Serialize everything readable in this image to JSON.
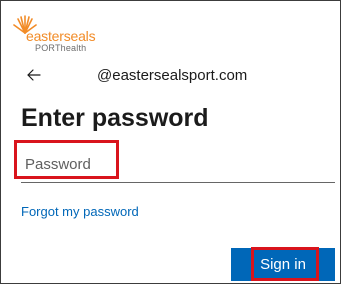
{
  "logo": {
    "brand_text": "easterseals",
    "sub_text": "PORThealth",
    "brand_color": "#f28c28"
  },
  "header": {
    "back_icon": "arrow-left-icon",
    "email": "@eastersealsport.com"
  },
  "main": {
    "title": "Enter password",
    "password_field": {
      "placeholder": "Password",
      "value": ""
    },
    "forgot_link": "Forgot my password",
    "sign_in_label": "Sign in"
  },
  "colors": {
    "accent": "#0067b8",
    "highlight": "#d9141c",
    "text": "#1b1b1b"
  }
}
